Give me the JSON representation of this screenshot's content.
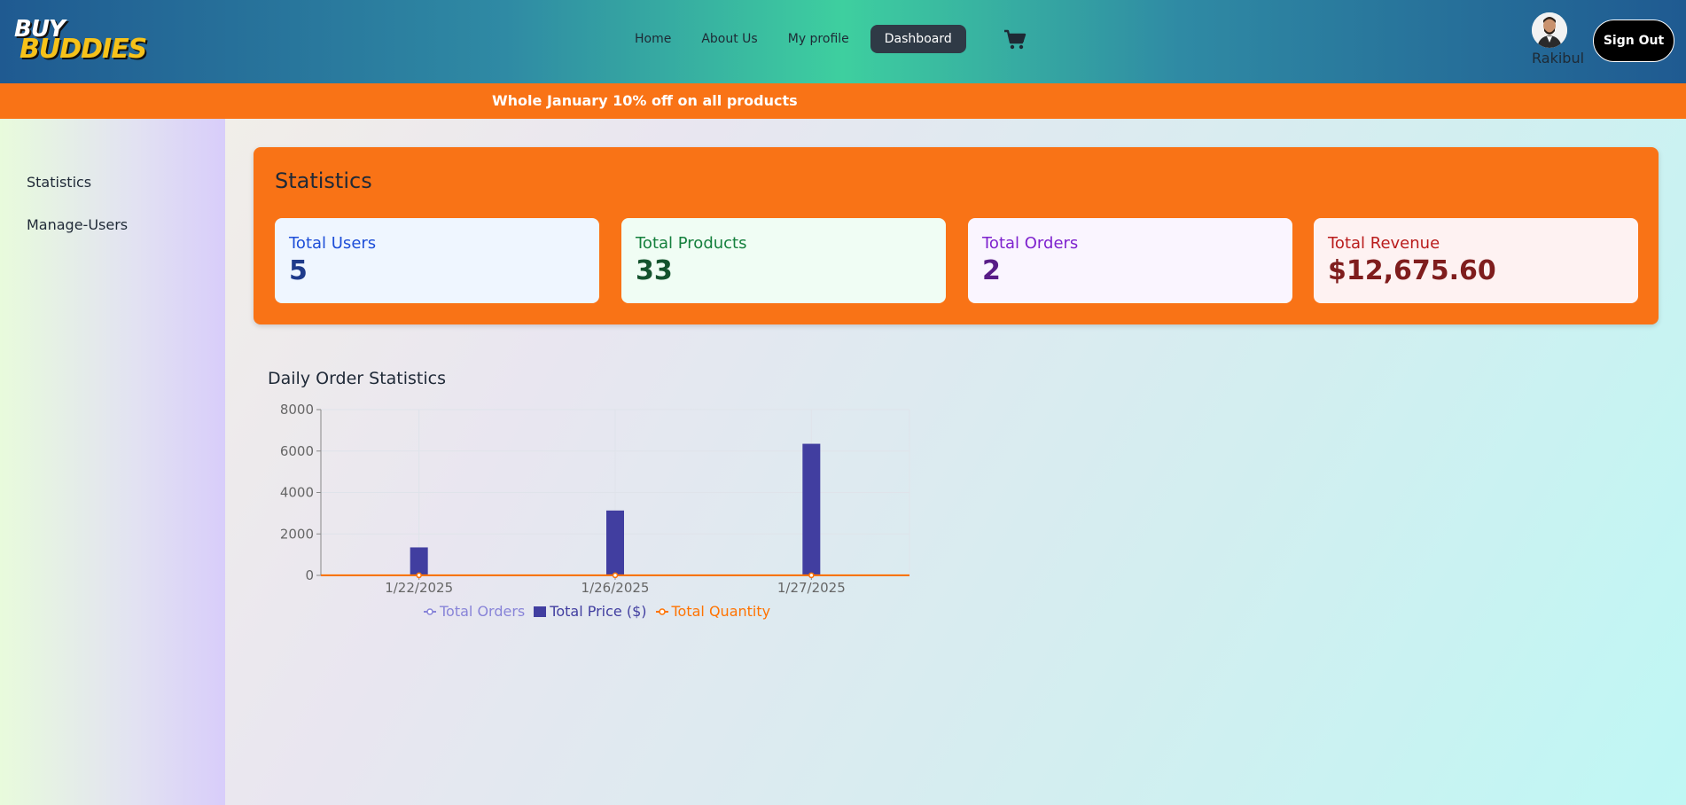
{
  "brand": {
    "line1": "BUY",
    "line2": "BUDDIES"
  },
  "nav": {
    "links": [
      {
        "label": "Home"
      },
      {
        "label": "About Us"
      },
      {
        "label": "My profile"
      },
      {
        "label": "Dashboard"
      }
    ],
    "active_index": 3,
    "cart_icon": "shopping-cart-icon"
  },
  "user": {
    "name": "Rakibul",
    "signout_label": "Sign Out"
  },
  "promo": {
    "text": "Whole January 10% off on all products"
  },
  "sidebar": {
    "items": [
      {
        "label": "Statistics"
      },
      {
        "label": "Manage-Users"
      }
    ]
  },
  "stats": {
    "title": "Statistics",
    "cards": [
      {
        "label": "Total Users",
        "value": "5",
        "bg": "#eff6ff",
        "color": "#1d4ed8",
        "value_color": "#1e3a8a"
      },
      {
        "label": "Total Products",
        "value": "33",
        "bg": "#f0fdf4",
        "color": "#15803d",
        "value_color": "#14532d"
      },
      {
        "label": "Total Orders",
        "value": "2",
        "bg": "#faf5ff",
        "color": "#7e22ce",
        "value_color": "#581c87"
      },
      {
        "label": "Total Revenue",
        "value": "$12,675.60",
        "bg": "#fef2f2",
        "color": "#b91c1c",
        "value_color": "#7f1d1d"
      }
    ]
  },
  "chart_title": "Daily Order Statistics",
  "chart_data": {
    "type": "bar",
    "categories": [
      "1/22/2025",
      "1/26/2025",
      "1/27/2025"
    ],
    "ylim": [
      0,
      8000
    ],
    "yticks": [
      0,
      2000,
      4000,
      6000,
      8000
    ],
    "grid": true,
    "legend_position": "bottom",
    "series": [
      {
        "name": "Total Orders",
        "kind": "line",
        "color": "#8884d8",
        "values": [
          1,
          1,
          1
        ]
      },
      {
        "name": "Total Price ($)",
        "kind": "bar",
        "color": "#413ea0",
        "values": [
          1350,
          3130,
          6350
        ]
      },
      {
        "name": "Total Quantity",
        "kind": "line",
        "color": "#ff7300",
        "values": [
          3,
          5,
          8
        ]
      }
    ]
  }
}
